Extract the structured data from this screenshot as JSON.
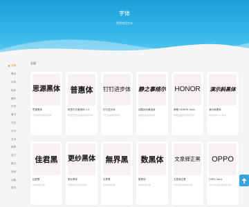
{
  "hero": {
    "title": "字体",
    "subtitle": "免费商用字体"
  },
  "sidebar": {
    "items": [
      {
        "label": "全部"
      },
      {
        "label": "黑体"
      },
      {
        "label": "宋体"
      },
      {
        "label": "楷体"
      },
      {
        "label": "圆体"
      },
      {
        "label": "仿宋"
      },
      {
        "label": "隶书"
      },
      {
        "label": "书法"
      },
      {
        "label": "手写"
      },
      {
        "label": "艺术"
      },
      {
        "label": "像素"
      },
      {
        "label": "英文"
      },
      {
        "label": "数字"
      },
      {
        "label": "其他"
      },
      {
        "label": "合集"
      },
      {
        "label": "更多"
      }
    ]
  },
  "main": {
    "section_title": "全部",
    "cards": [
      {
        "preview": "思源黑体",
        "name": "思源黑体",
        "desc": "开源免费可商用字体",
        "meta": "☆"
      },
      {
        "preview": "普惠体",
        "name": "阿里巴巴普惠体 2.0",
        "desc": "阿里巴巴出品免费商用字体",
        "meta": "☆"
      },
      {
        "preview": "钉钉进步体",
        "name": "钉钉进步体",
        "desc": "钉钉出品免费商用",
        "meta": "☆"
      },
      {
        "preview": "静之事络尔",
        "name": "站酷庆科黄油体",
        "desc": "站酷出品免费商用",
        "meta": "☆"
      },
      {
        "preview": "HONOR",
        "name": "荣耀 HONOR Sans",
        "desc": "荣耀出品免费商用字体",
        "meta": "☆"
      },
      {
        "preview": "演示斜黑体",
        "name": "演示斜黑体",
        "desc": "免费商用 Pro 版本",
        "meta": "☆"
      },
      {
        "preview": "佳君黑",
        "name": "佳君黑",
        "desc": "免费商用字体",
        "meta": "☆"
      },
      {
        "preview": "更纱黑体",
        "name": "更纱黑体",
        "desc": "开源免费可商用字体",
        "meta": "☆"
      },
      {
        "preview": "無界黑",
        "name": "无界黑",
        "desc": "免费商用字体",
        "meta": "☆"
      },
      {
        "preview": "数黑体",
        "name": "数黑体",
        "desc": "免费商用字体",
        "meta": "☆"
      },
      {
        "preview": "文泉驿正黑",
        "name": "文泉驿正黑",
        "desc": "开源免费可商用字体",
        "meta": "☆"
      },
      {
        "preview": "OPPO",
        "name": "OPPO Sans",
        "desc": "OPPO出品免费商用字体",
        "meta": "☆"
      }
    ]
  },
  "colors": {
    "accent": "#f08a2a",
    "header": "#1aa0d8",
    "back_top": "#3aa3dd"
  },
  "icons": {
    "back_top": "arrow-up-icon",
    "favorite": "star-icon"
  }
}
